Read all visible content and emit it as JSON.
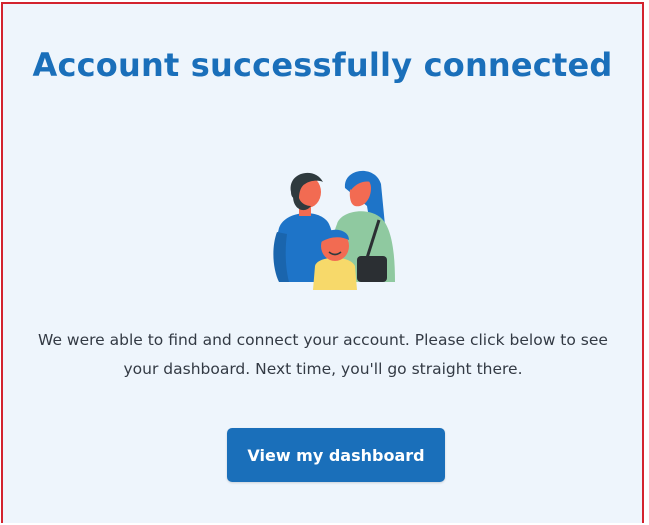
{
  "page": {
    "title": "Account successfully connected",
    "message": "We were able to find and connect your account. Please click below to see your dashboard. Next time, you'll go straight there.",
    "cta_label": "View my dashboard"
  },
  "illustration": {
    "icon": "family-illustration",
    "colors": {
      "dark_hair": "#2f3a3e",
      "skin": "#f26b52",
      "blue_shirt": "#1e74c8",
      "green_top": "#8fc9a0",
      "yellow_shirt": "#f7d96a",
      "bag": "#2b2f33"
    }
  },
  "colors": {
    "accent": "#1a6fba",
    "frame_border": "#d3232e",
    "background": "#eef5fc",
    "text": "#333a44"
  }
}
